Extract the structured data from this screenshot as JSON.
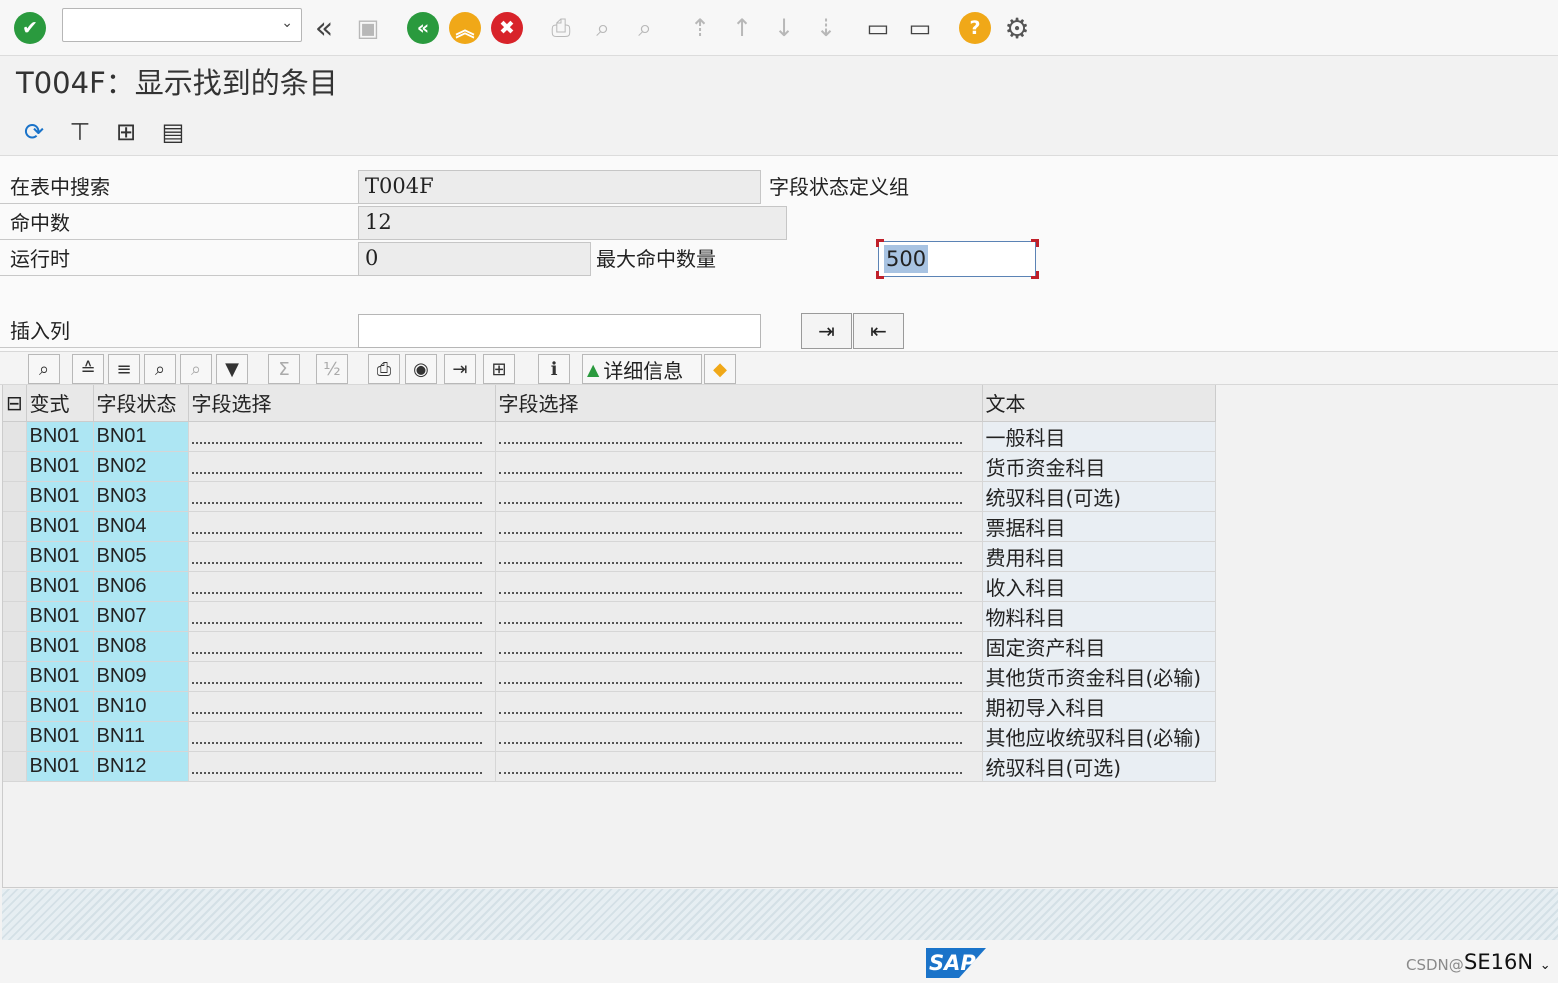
{
  "window": {
    "title": "T004F：显示找到的条目",
    "command_field_value": ""
  },
  "form": {
    "search_table_label": "在表中搜索",
    "search_table_value": "T004F",
    "table_description": "字段状态定义组",
    "hits_label": "命中数",
    "hits_value": "12",
    "runtime_label": "运行时",
    "runtime_value": "0",
    "max_hits_label": "最大命中数量",
    "max_hits_value": "500",
    "insert_col_label": "插入列",
    "insert_col_value": ""
  },
  "grid_toolbar": {
    "detail_label": "详细信息"
  },
  "grid": {
    "columns": [
      "变式",
      "字段状态",
      "字段选择",
      "字段选择",
      "文本"
    ],
    "rows": [
      {
        "variant": "BN01",
        "status": "BN01",
        "text": "一般科目"
      },
      {
        "variant": "BN01",
        "status": "BN02",
        "text": "货币资金科目"
      },
      {
        "variant": "BN01",
        "status": "BN03",
        "text": "统驭科目(可选)"
      },
      {
        "variant": "BN01",
        "status": "BN04",
        "text": "票据科目"
      },
      {
        "variant": "BN01",
        "status": "BN05",
        "text": "费用科目"
      },
      {
        "variant": "BN01",
        "status": "BN06",
        "text": "收入科目"
      },
      {
        "variant": "BN01",
        "status": "BN07",
        "text": "物料科目"
      },
      {
        "variant": "BN01",
        "status": "BN08",
        "text": "固定资产科目"
      },
      {
        "variant": "BN01",
        "status": "BN09",
        "text": "其他货币资金科目(必输)"
      },
      {
        "variant": "BN01",
        "status": "BN10",
        "text": "期初导入科目"
      },
      {
        "variant": "BN01",
        "status": "BN11",
        "text": "其他应收统驭科目(必输)"
      },
      {
        "variant": "BN01",
        "status": "BN12",
        "text": "统驭科目(可选)"
      }
    ]
  },
  "statusbar": {
    "logo": "SAP",
    "tcode": "SE16N",
    "watermark": "CSDN@"
  },
  "icons": [
    "check-icon",
    "back-icon",
    "save-icon",
    "exit-icon",
    "cancel-icon",
    "print-icon",
    "find-icon",
    "help-icon",
    "settings-icon"
  ]
}
